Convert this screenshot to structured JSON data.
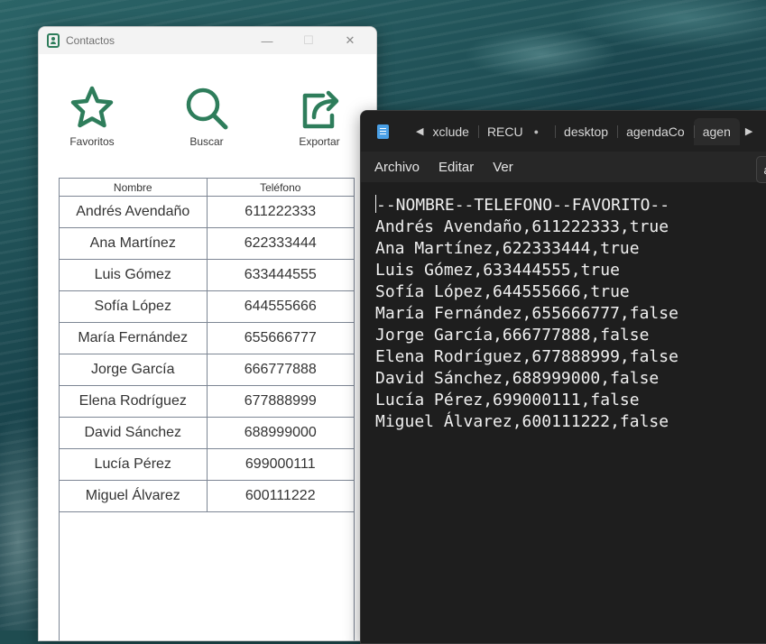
{
  "contacts_window": {
    "title": "Contactos",
    "controls": {
      "minimize": "—",
      "maximize": "☐",
      "close": "✕"
    },
    "toolbar": [
      {
        "label": "Favoritos",
        "icon": "star-icon"
      },
      {
        "label": "Buscar",
        "icon": "search-icon"
      },
      {
        "label": "Exportar",
        "icon": "share-icon"
      }
    ],
    "table": {
      "headers": [
        "Nombre",
        "Teléfono"
      ],
      "rows": [
        [
          "Andrés Avendaño",
          "611222333"
        ],
        [
          "Ana Martínez",
          "622333444"
        ],
        [
          "Luis Gómez",
          "633444555"
        ],
        [
          "Sofía López",
          "644555666"
        ],
        [
          "María Fernández",
          "655666777"
        ],
        [
          "Jorge García",
          "666777888"
        ],
        [
          "Elena Rodríguez",
          "677888999"
        ],
        [
          "David Sánchez",
          "688999000"
        ],
        [
          "Lucía Pérez",
          "699000111"
        ],
        [
          "Miguel Álvarez",
          "600111222"
        ]
      ]
    },
    "accent_color": "#2e7d5b"
  },
  "notepad": {
    "tabs": [
      "xclude",
      "RECU",
      "desktop",
      "agendaCo",
      "agen"
    ],
    "active_tab": "agen",
    "unsaved_dot": "●",
    "menu": [
      "Archivo",
      "Editar",
      "Ver"
    ],
    "tooltip": "ag",
    "lines": [
      "--NOMBRE--TELEFONO--FAVORITO--",
      "Andrés Avendaño,611222333,true",
      "Ana Martínez,622333444,true",
      "Luis Gómez,633444555,true",
      "Sofía López,644555666,true",
      "María Fernández,655666777,false",
      "Jorge García,666777888,false",
      "Elena Rodríguez,677888999,false",
      "David Sánchez,688999000,false",
      "Lucía Pérez,699000111,false",
      "Miguel Álvarez,600111222,false"
    ]
  }
}
